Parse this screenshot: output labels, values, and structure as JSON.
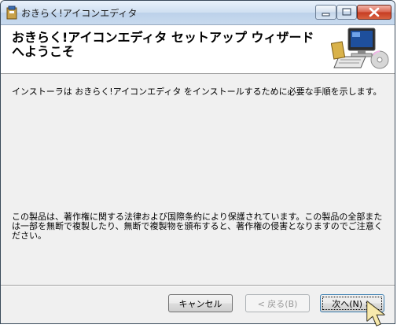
{
  "window": {
    "title": "おきらく!アイコンエディタ"
  },
  "header": {
    "title": "おきらく!アイコンエディタ セットアップ ウィザードへようこそ"
  },
  "body": {
    "intro": "インストーラは おきらく!アイコンエディタ をインストールするために必要な手順を示します。",
    "notice": "この製品は、著作権に関する法律および国際条約により保護されています。この製品の全部または一部を無断で複製したり、無断で複製物を頒布すると、著作権の侵害となりますのでご注意ください。"
  },
  "buttons": {
    "cancel": "キャンセル",
    "back": "< 戻る(B)",
    "next": "次へ(N) >"
  },
  "colors": {
    "title_bar": "#c8daee",
    "close_button": "#c63b21",
    "dialog_bg": "#f0f0f0"
  },
  "icons": [
    "installer-icon",
    "minimize-icon",
    "maximize-icon",
    "close-icon",
    "computer-setup-icon",
    "cursor-arrow-icon"
  ]
}
